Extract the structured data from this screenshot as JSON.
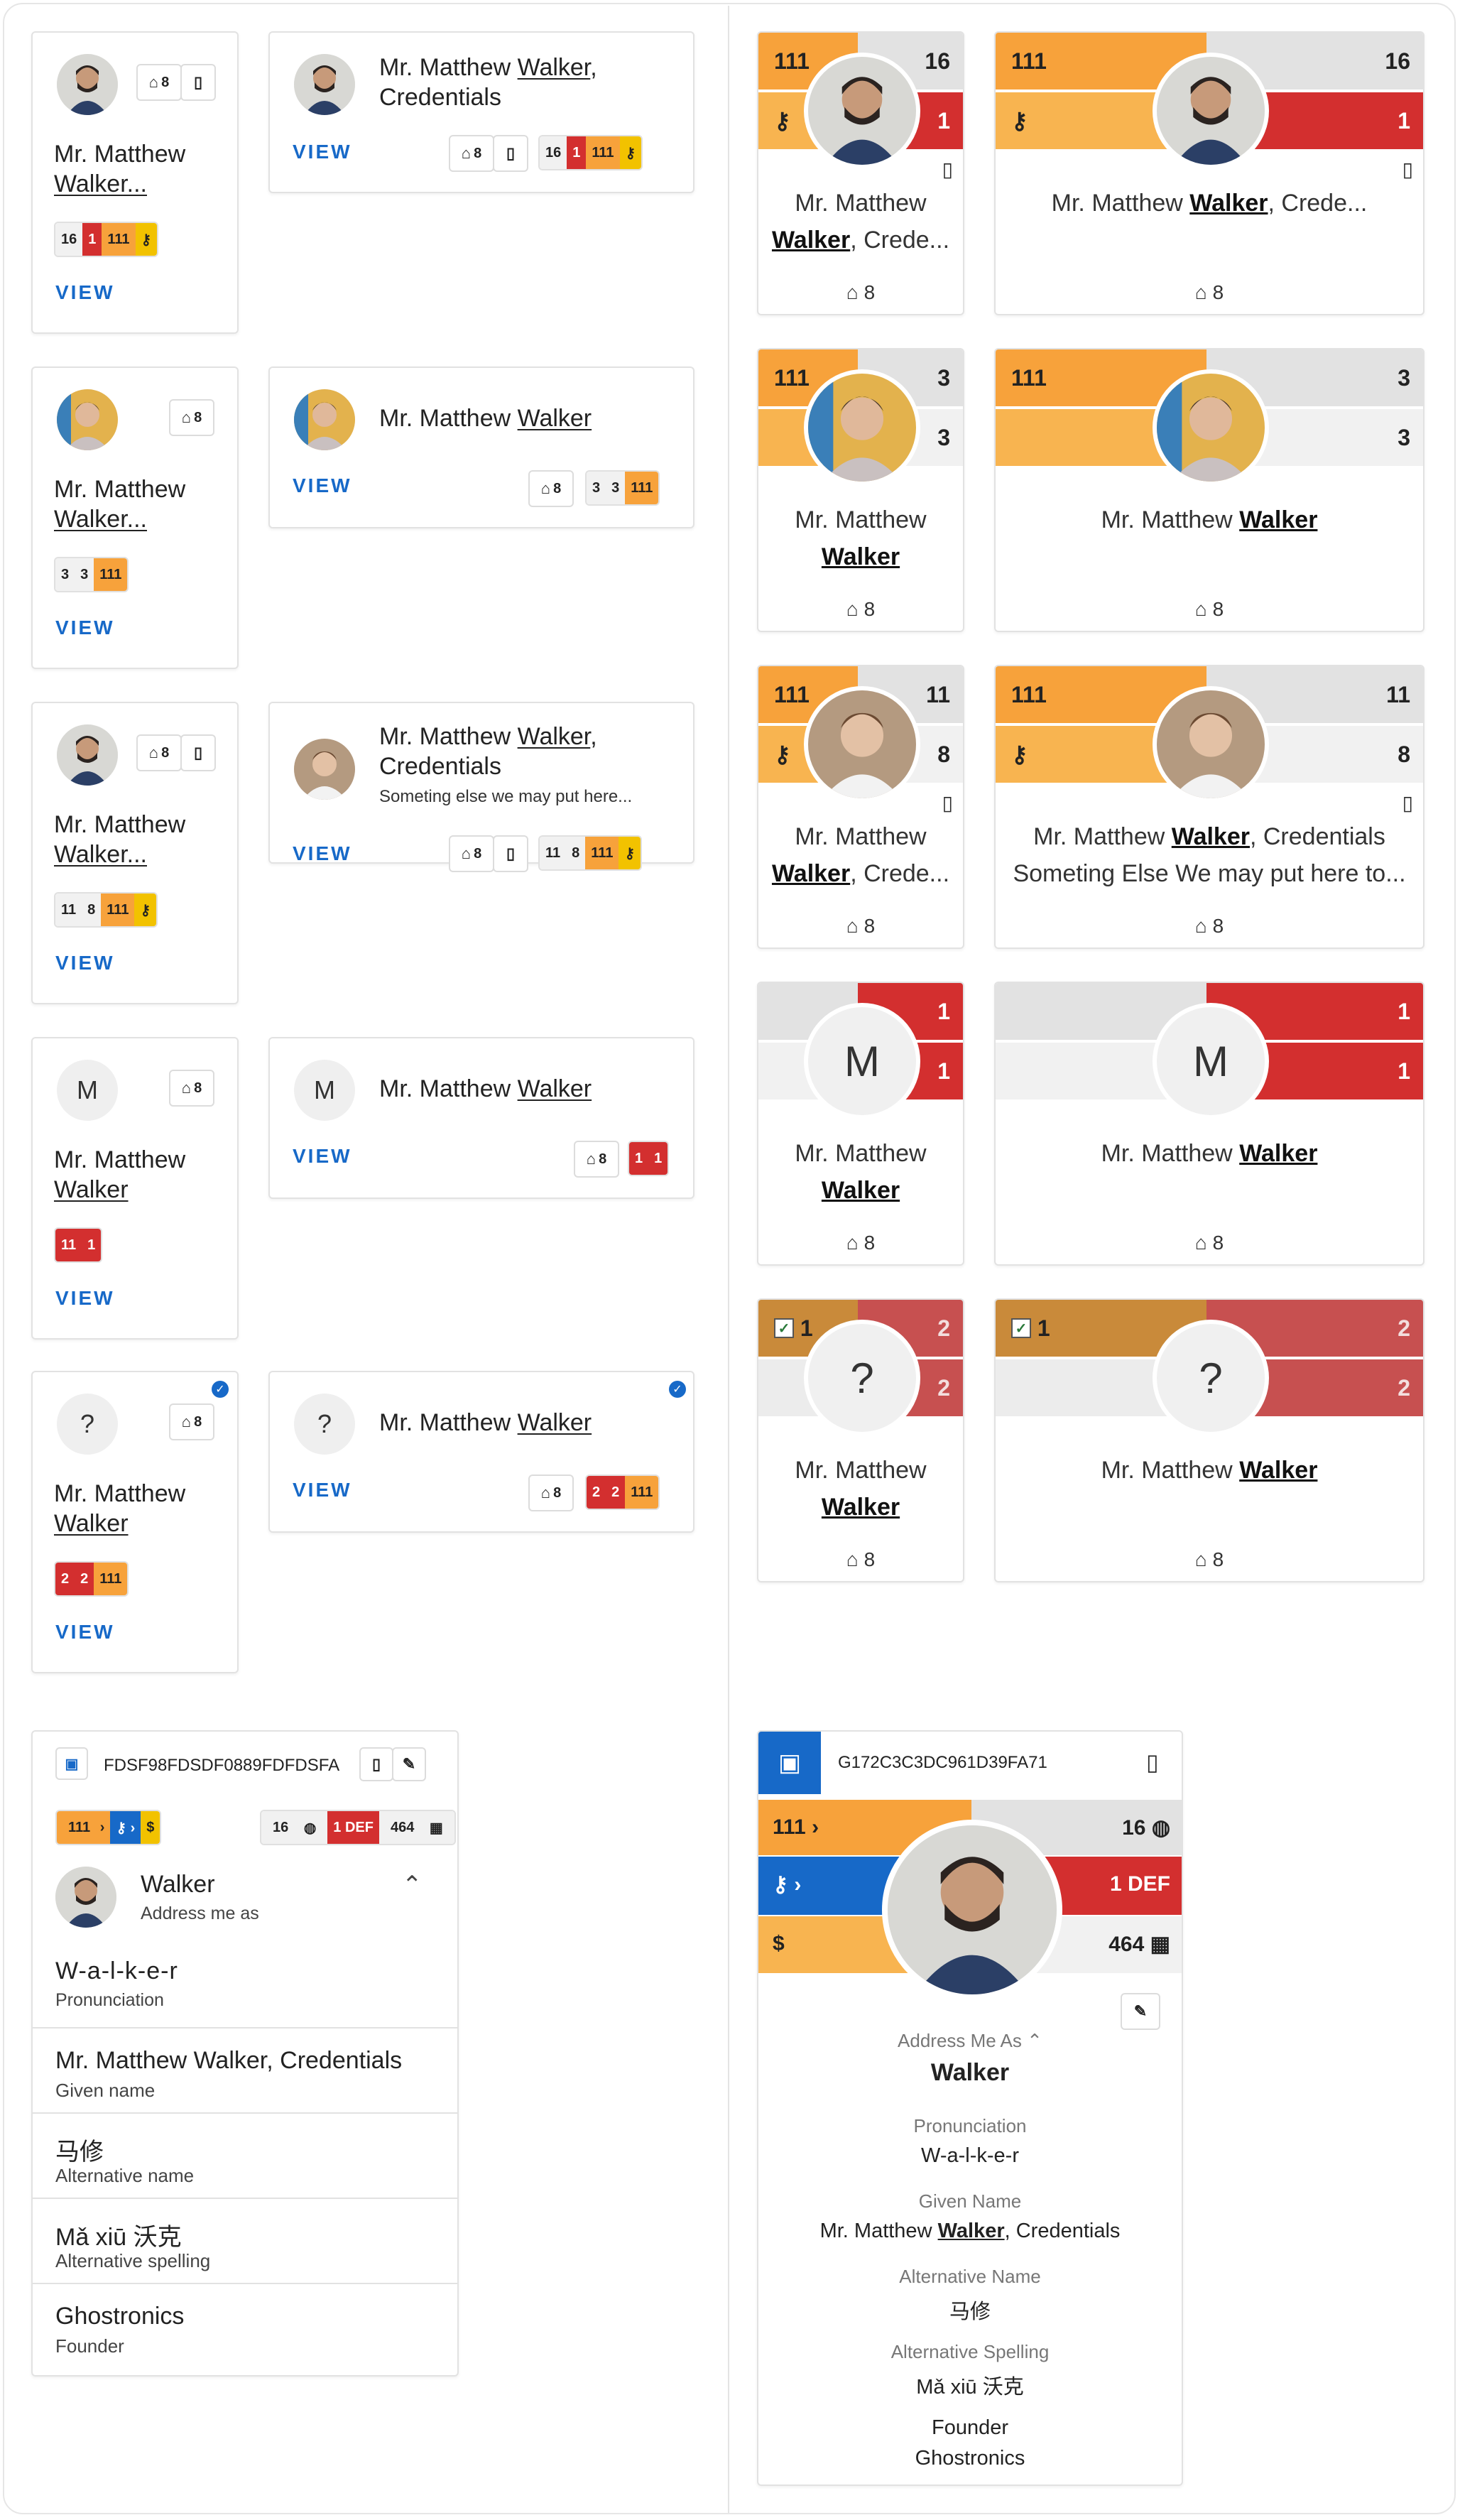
{
  "colors": {
    "accent": "#1769c8",
    "red": "#d32f2f",
    "orange": "#f7a23b",
    "yellow": "#f2c200",
    "grey": "#dcdcdc"
  },
  "person": {
    "short": "Mr. Matthew Walker...",
    "line1": "Mr. Matthew",
    "line2": "Walker...",
    "line2_plain": "Walker",
    "full_pre": "Mr. Matthew ",
    "surname": "Walker",
    "cred": ", Credentials",
    "cred_short": ", Crede...",
    "extra": "Someting else we may put here...",
    "extra_big": "Someting Else We may put here to...",
    "initial": "M",
    "unknown": "?"
  },
  "view_label": "VIEW",
  "counts": {
    "home": "8",
    "n16": "16",
    "n1": "1",
    "n111": "111",
    "n3": "3",
    "n11": "11",
    "n2": "2"
  },
  "icons": {
    "home": "home-icon",
    "phone": "phone-icon",
    "key": "key-icon",
    "check": "verified-check-icon"
  },
  "detail": {
    "id": "FDSF98FDSDF0889FDFDSFA",
    "badges": {
      "a": "111",
      "b": "→",
      "c": "$",
      "d": "16",
      "e": "1 DEF",
      "f": "464"
    },
    "address_name": "Walker",
    "address_label": "Address me as",
    "pron": "W-a-l-k-e-r",
    "pron_label": "Pronunciation",
    "given": "Mr. Matthew Walker, Credentials",
    "given_label": "Given name",
    "alt": "马修",
    "alt_label": "Alternative name",
    "alts": "Mǎ xiū 沃克",
    "alts_label": "Alternative spelling",
    "org": "Ghostronics",
    "role": "Founder"
  },
  "detail_big": {
    "id": "G172C3C3DC961D39FA71",
    "b111": "111",
    "b16": "16",
    "b1def": "1 DEF",
    "b464": "464",
    "dollar": "$",
    "address_label": "Address Me As",
    "address_name": "Walker",
    "pron_label": "Pronunciation",
    "pron": "W-a-l-k-e-r",
    "given_label": "Given Name",
    "given_pre": "Mr. Matthew ",
    "given_sur": "Walker",
    "given_post": ", Credentials",
    "alt_label": "Alternative Name",
    "alt": "马修",
    "alts_label": "Alternative Spelling",
    "alts": "Mǎ xiū 沃克",
    "role": "Founder",
    "org": "Ghostronics"
  }
}
